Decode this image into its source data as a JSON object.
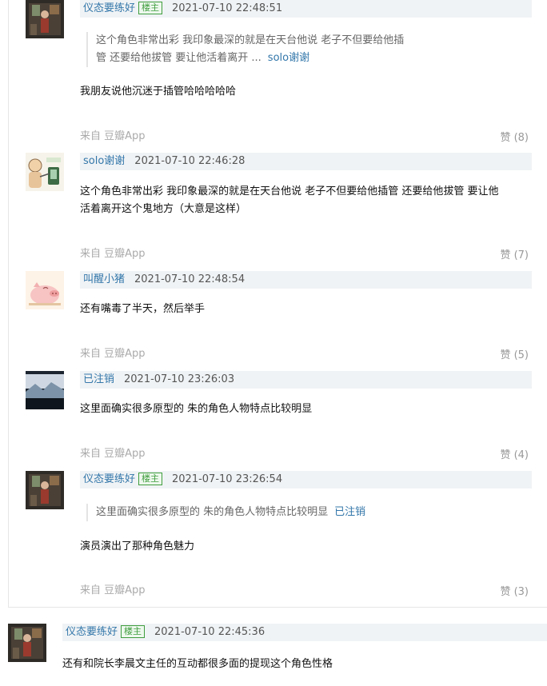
{
  "replies": [
    {
      "author": "仪态要练好",
      "badge": "楼主",
      "time": "2021-07-10 22:48:51",
      "quote_line1": "这个角色非常出彩 我印象最深的就是在天台他说 老子不但要给他插",
      "quote_line2": "管 还要给他拔管 要让他活着离开 ...",
      "quote_author": "solo谢谢",
      "content": "我朋友说他沉迷于插管哈哈哈哈哈",
      "source": "来自 豆瓣App",
      "likes": "赞 (8)",
      "avatar_icon": "user-avatar-photo"
    },
    {
      "author": "solo谢谢",
      "time": "2021-07-10 22:46:28",
      "content_line1": "这个角色非常出彩 我印象最深的就是在天台他说 老子不但要给他插管 还要给他拔管 要让他",
      "content_line2": "活着离开这个鬼地方（大意是这样）",
      "source": "来自 豆瓣App",
      "likes": "赞 (7)",
      "avatar_icon": "cartoon-avatar"
    },
    {
      "author": "叫醒小猪",
      "time": "2021-07-10 22:48:54",
      "content": "还有嘴毒了半天，然后举手",
      "source": "来自 豆瓣App",
      "likes": "赞 (5)",
      "avatar_icon": "pig-avatar"
    },
    {
      "author": "已注销",
      "time": "2021-07-10 23:26:03",
      "content": "这里面确实很多原型的 朱的角色人物特点比较明显",
      "source": "来自 豆瓣App",
      "likes": "赞 (4)",
      "avatar_icon": "landscape-avatar"
    },
    {
      "author": "仪态要练好",
      "badge": "楼主",
      "time": "2021-07-10 23:26:54",
      "quote": "这里面确实很多原型的 朱的角色人物特点比较明显",
      "quote_author": "已注销",
      "content": "演员演出了那种角色魅力",
      "source": "来自 豆瓣App",
      "likes": "赞 (3)",
      "avatar_icon": "user-avatar-photo"
    }
  ],
  "top_comment": {
    "author": "仪态要练好",
    "badge": "楼主",
    "time": "2021-07-10 22:45:36",
    "content": "还有和院长李晨文主任的互动都很多面的提现这个角色性格",
    "avatar_icon": "user-avatar-photo"
  },
  "colors": {
    "link": "#3377aa",
    "badge": "#3f9d3f",
    "header_bg": "#f0f3f5",
    "muted": "#aaaaaa"
  }
}
